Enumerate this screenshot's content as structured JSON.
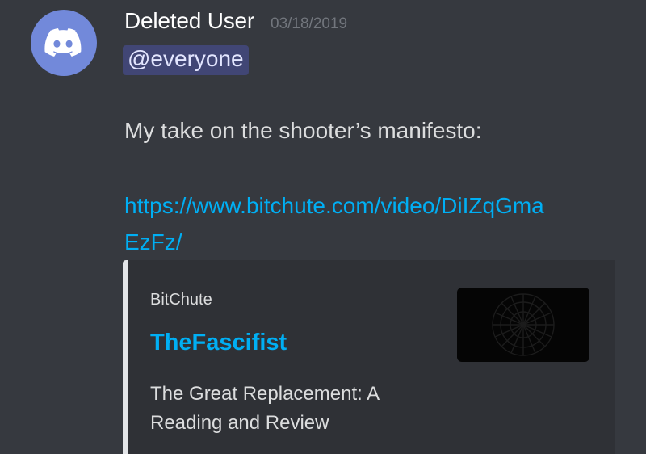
{
  "message": {
    "avatar_icon": "discord-logo-icon",
    "username": "Deleted User",
    "timestamp": "03/18/2019",
    "mention": "@everyone",
    "content": "My take on the shooter’s manifesto:",
    "link_line1": "https://www.bitchute.com/video/DiIZqGma",
    "link_line2": "EzFz/"
  },
  "embed": {
    "provider": "BitChute",
    "title": "TheFascifist",
    "description": "The Great Replacement: A Reading and Review",
    "thumbnail_icon": "dark-wheel-thumbnail"
  },
  "colors": {
    "background": "#36393f",
    "embed_background": "#2f3136",
    "avatar": "#7289da",
    "link": "#00aff4",
    "mention_bg": "#414675"
  }
}
